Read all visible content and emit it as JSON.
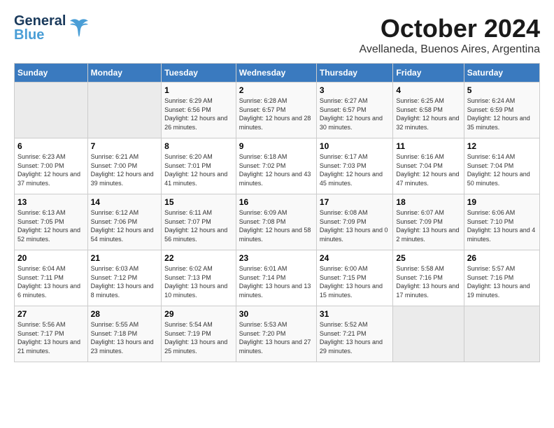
{
  "logo": {
    "general": "General",
    "blue": "Blue"
  },
  "title": "October 2024",
  "location": "Avellaneda, Buenos Aires, Argentina",
  "weekdays": [
    "Sunday",
    "Monday",
    "Tuesday",
    "Wednesday",
    "Thursday",
    "Friday",
    "Saturday"
  ],
  "weeks": [
    [
      {
        "day": "",
        "sunrise": "",
        "sunset": "",
        "daylight": ""
      },
      {
        "day": "",
        "sunrise": "",
        "sunset": "",
        "daylight": ""
      },
      {
        "day": "1",
        "sunrise": "Sunrise: 6:29 AM",
        "sunset": "Sunset: 6:56 PM",
        "daylight": "Daylight: 12 hours and 26 minutes."
      },
      {
        "day": "2",
        "sunrise": "Sunrise: 6:28 AM",
        "sunset": "Sunset: 6:57 PM",
        "daylight": "Daylight: 12 hours and 28 minutes."
      },
      {
        "day": "3",
        "sunrise": "Sunrise: 6:27 AM",
        "sunset": "Sunset: 6:57 PM",
        "daylight": "Daylight: 12 hours and 30 minutes."
      },
      {
        "day": "4",
        "sunrise": "Sunrise: 6:25 AM",
        "sunset": "Sunset: 6:58 PM",
        "daylight": "Daylight: 12 hours and 32 minutes."
      },
      {
        "day": "5",
        "sunrise": "Sunrise: 6:24 AM",
        "sunset": "Sunset: 6:59 PM",
        "daylight": "Daylight: 12 hours and 35 minutes."
      }
    ],
    [
      {
        "day": "6",
        "sunrise": "Sunrise: 6:23 AM",
        "sunset": "Sunset: 7:00 PM",
        "daylight": "Daylight: 12 hours and 37 minutes."
      },
      {
        "day": "7",
        "sunrise": "Sunrise: 6:21 AM",
        "sunset": "Sunset: 7:00 PM",
        "daylight": "Daylight: 12 hours and 39 minutes."
      },
      {
        "day": "8",
        "sunrise": "Sunrise: 6:20 AM",
        "sunset": "Sunset: 7:01 PM",
        "daylight": "Daylight: 12 hours and 41 minutes."
      },
      {
        "day": "9",
        "sunrise": "Sunrise: 6:18 AM",
        "sunset": "Sunset: 7:02 PM",
        "daylight": "Daylight: 12 hours and 43 minutes."
      },
      {
        "day": "10",
        "sunrise": "Sunrise: 6:17 AM",
        "sunset": "Sunset: 7:03 PM",
        "daylight": "Daylight: 12 hours and 45 minutes."
      },
      {
        "day": "11",
        "sunrise": "Sunrise: 6:16 AM",
        "sunset": "Sunset: 7:04 PM",
        "daylight": "Daylight: 12 hours and 47 minutes."
      },
      {
        "day": "12",
        "sunrise": "Sunrise: 6:14 AM",
        "sunset": "Sunset: 7:04 PM",
        "daylight": "Daylight: 12 hours and 50 minutes."
      }
    ],
    [
      {
        "day": "13",
        "sunrise": "Sunrise: 6:13 AM",
        "sunset": "Sunset: 7:05 PM",
        "daylight": "Daylight: 12 hours and 52 minutes."
      },
      {
        "day": "14",
        "sunrise": "Sunrise: 6:12 AM",
        "sunset": "Sunset: 7:06 PM",
        "daylight": "Daylight: 12 hours and 54 minutes."
      },
      {
        "day": "15",
        "sunrise": "Sunrise: 6:11 AM",
        "sunset": "Sunset: 7:07 PM",
        "daylight": "Daylight: 12 hours and 56 minutes."
      },
      {
        "day": "16",
        "sunrise": "Sunrise: 6:09 AM",
        "sunset": "Sunset: 7:08 PM",
        "daylight": "Daylight: 12 hours and 58 minutes."
      },
      {
        "day": "17",
        "sunrise": "Sunrise: 6:08 AM",
        "sunset": "Sunset: 7:09 PM",
        "daylight": "Daylight: 13 hours and 0 minutes."
      },
      {
        "day": "18",
        "sunrise": "Sunrise: 6:07 AM",
        "sunset": "Sunset: 7:09 PM",
        "daylight": "Daylight: 13 hours and 2 minutes."
      },
      {
        "day": "19",
        "sunrise": "Sunrise: 6:06 AM",
        "sunset": "Sunset: 7:10 PM",
        "daylight": "Daylight: 13 hours and 4 minutes."
      }
    ],
    [
      {
        "day": "20",
        "sunrise": "Sunrise: 6:04 AM",
        "sunset": "Sunset: 7:11 PM",
        "daylight": "Daylight: 13 hours and 6 minutes."
      },
      {
        "day": "21",
        "sunrise": "Sunrise: 6:03 AM",
        "sunset": "Sunset: 7:12 PM",
        "daylight": "Daylight: 13 hours and 8 minutes."
      },
      {
        "day": "22",
        "sunrise": "Sunrise: 6:02 AM",
        "sunset": "Sunset: 7:13 PM",
        "daylight": "Daylight: 13 hours and 10 minutes."
      },
      {
        "day": "23",
        "sunrise": "Sunrise: 6:01 AM",
        "sunset": "Sunset: 7:14 PM",
        "daylight": "Daylight: 13 hours and 13 minutes."
      },
      {
        "day": "24",
        "sunrise": "Sunrise: 6:00 AM",
        "sunset": "Sunset: 7:15 PM",
        "daylight": "Daylight: 13 hours and 15 minutes."
      },
      {
        "day": "25",
        "sunrise": "Sunrise: 5:58 AM",
        "sunset": "Sunset: 7:16 PM",
        "daylight": "Daylight: 13 hours and 17 minutes."
      },
      {
        "day": "26",
        "sunrise": "Sunrise: 5:57 AM",
        "sunset": "Sunset: 7:16 PM",
        "daylight": "Daylight: 13 hours and 19 minutes."
      }
    ],
    [
      {
        "day": "27",
        "sunrise": "Sunrise: 5:56 AM",
        "sunset": "Sunset: 7:17 PM",
        "daylight": "Daylight: 13 hours and 21 minutes."
      },
      {
        "day": "28",
        "sunrise": "Sunrise: 5:55 AM",
        "sunset": "Sunset: 7:18 PM",
        "daylight": "Daylight: 13 hours and 23 minutes."
      },
      {
        "day": "29",
        "sunrise": "Sunrise: 5:54 AM",
        "sunset": "Sunset: 7:19 PM",
        "daylight": "Daylight: 13 hours and 25 minutes."
      },
      {
        "day": "30",
        "sunrise": "Sunrise: 5:53 AM",
        "sunset": "Sunset: 7:20 PM",
        "daylight": "Daylight: 13 hours and 27 minutes."
      },
      {
        "day": "31",
        "sunrise": "Sunrise: 5:52 AM",
        "sunset": "Sunset: 7:21 PM",
        "daylight": "Daylight: 13 hours and 29 minutes."
      },
      {
        "day": "",
        "sunrise": "",
        "sunset": "",
        "daylight": ""
      },
      {
        "day": "",
        "sunrise": "",
        "sunset": "",
        "daylight": ""
      }
    ]
  ]
}
